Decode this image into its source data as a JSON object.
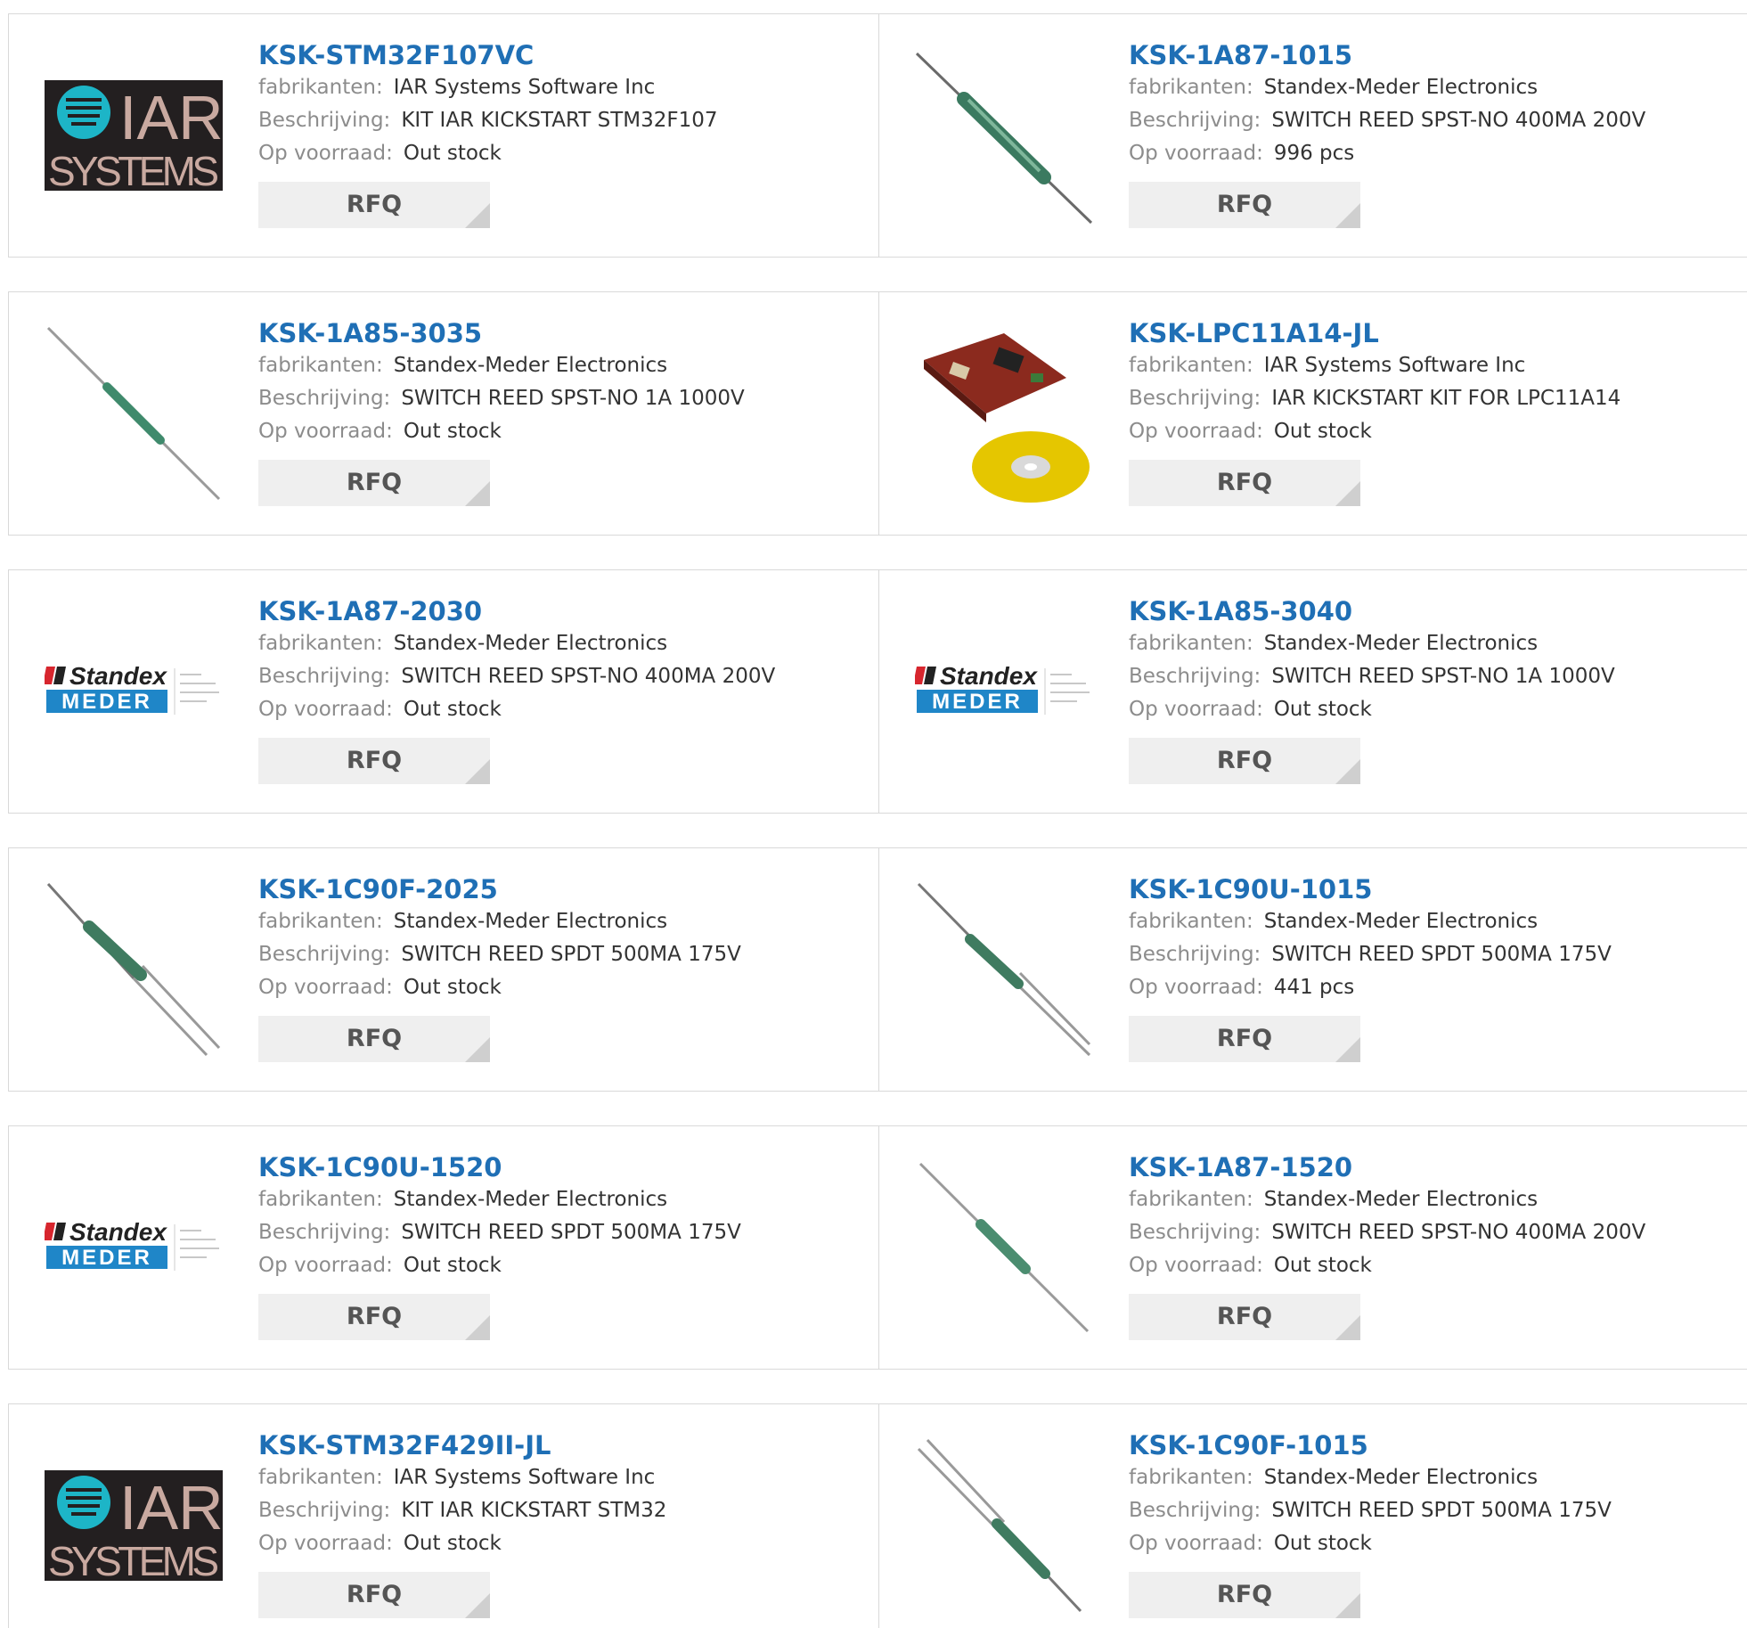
{
  "labels": {
    "manufacturer": "fabrikanten:",
    "description": "Beschrijving:",
    "stock": "Op voorraad:",
    "rfq": "RFQ"
  },
  "colors": {
    "title_link": "#1f6fb5",
    "label": "#8c8c8c",
    "value": "#333333",
    "rfq_bg": "#efefef",
    "border": "#d9d9d9"
  },
  "products": [
    {
      "part": "KSK-STM32F107VC",
      "manufacturer": "IAR Systems Software Inc",
      "description": "KIT IAR KICKSTART STM32F107",
      "stock": "Out stock",
      "image": "iar-systems-logo"
    },
    {
      "part": "KSK-1A87-1015",
      "manufacturer": "Standex-Meder Electronics",
      "description": "SWITCH REED SPST-NO 400MA 200V",
      "stock": "996 pcs",
      "image": "reed-switch"
    },
    {
      "part": "KSK-1A85-3035",
      "manufacturer": "Standex-Meder Electronics",
      "description": "SWITCH REED SPST-NO 1A 1000V",
      "stock": "Out stock",
      "image": "reed-switch"
    },
    {
      "part": "KSK-LPC11A14-JL",
      "manufacturer": "IAR Systems Software Inc",
      "description": "IAR KICKSTART KIT FOR LPC11A14",
      "stock": "Out stock",
      "image": "dev-board-with-cd"
    },
    {
      "part": "KSK-1A87-2030",
      "manufacturer": "Standex-Meder Electronics",
      "description": "SWITCH REED SPST-NO 400MA 200V",
      "stock": "Out stock",
      "image": "standex-meder-logo"
    },
    {
      "part": "KSK-1A85-3040",
      "manufacturer": "Standex-Meder Electronics",
      "description": "SWITCH REED SPST-NO 1A 1000V",
      "stock": "Out stock",
      "image": "standex-meder-logo"
    },
    {
      "part": "KSK-1C90F-2025",
      "manufacturer": "Standex-Meder Electronics",
      "description": "SWITCH REED SPDT 500MA 175V",
      "stock": "Out stock",
      "image": "reed-switch-spdt"
    },
    {
      "part": "KSK-1C90U-1015",
      "manufacturer": "Standex-Meder Electronics",
      "description": "SWITCH REED SPDT 500MA 175V",
      "stock": "441 pcs",
      "image": "reed-switch-spdt"
    },
    {
      "part": "KSK-1C90U-1520",
      "manufacturer": "Standex-Meder Electronics",
      "description": "SWITCH REED SPDT 500MA 175V",
      "stock": "Out stock",
      "image": "standex-meder-logo"
    },
    {
      "part": "KSK-1A87-1520",
      "manufacturer": "Standex-Meder Electronics",
      "description": "SWITCH REED SPST-NO 400MA 200V",
      "stock": "Out stock",
      "image": "reed-switch"
    },
    {
      "part": "KSK-STM32F429II-JL",
      "manufacturer": "IAR Systems Software Inc",
      "description": "KIT IAR KICKSTART STM32",
      "stock": "Out stock",
      "image": "iar-systems-logo"
    },
    {
      "part": "KSK-1C90F-1015",
      "manufacturer": "Standex-Meder Electronics",
      "description": "SWITCH REED SPDT 500MA 175V",
      "stock": "Out stock",
      "image": "reed-switch-spdt"
    }
  ]
}
